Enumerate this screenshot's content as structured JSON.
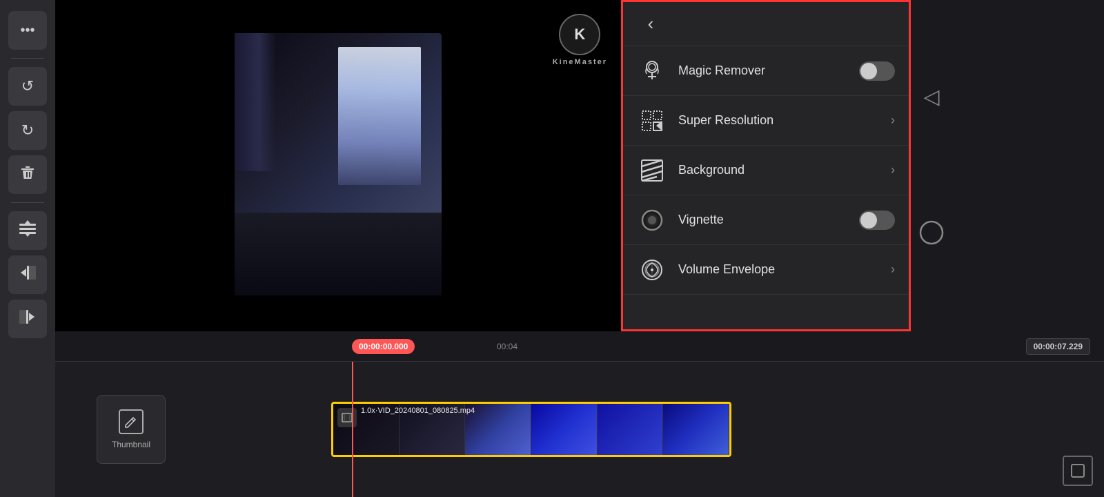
{
  "app": {
    "title": "KineMaster"
  },
  "sidebar": {
    "buttons": [
      {
        "id": "more",
        "icon": "⋯",
        "label": "more-options"
      },
      {
        "id": "undo",
        "icon": "↺",
        "label": "undo"
      },
      {
        "id": "redo",
        "icon": "↻",
        "label": "redo"
      },
      {
        "id": "delete",
        "icon": "🗑",
        "label": "delete"
      },
      {
        "id": "align",
        "icon": "⊟",
        "label": "align"
      },
      {
        "id": "trim-left",
        "icon": "◁|",
        "label": "trim-left"
      },
      {
        "id": "trim-right",
        "icon": "|▷",
        "label": "trim-right"
      }
    ]
  },
  "panel": {
    "back_label": "‹",
    "items": [
      {
        "id": "magic-remover",
        "label": "Magic Remover",
        "type": "toggle",
        "enabled": false
      },
      {
        "id": "super-resolution",
        "label": "Super Resolution",
        "type": "arrow"
      },
      {
        "id": "background",
        "label": "Background",
        "type": "arrow"
      },
      {
        "id": "vignette",
        "label": "Vignette",
        "type": "toggle",
        "enabled": false
      },
      {
        "id": "volume-envelope",
        "label": "Volume Envelope",
        "type": "arrow"
      }
    ]
  },
  "timeline": {
    "current_time": "00:00:00.000",
    "mid_time": "00:04",
    "end_time": "00:00:07.229",
    "clip": {
      "filename": "1.0x·VID_20240801_080825.mp4",
      "speed": "1.0x"
    }
  },
  "thumbnail": {
    "label": "Thumbnail"
  },
  "right_side": {
    "back_triangle": "◁",
    "circle": "○",
    "square": "□"
  }
}
